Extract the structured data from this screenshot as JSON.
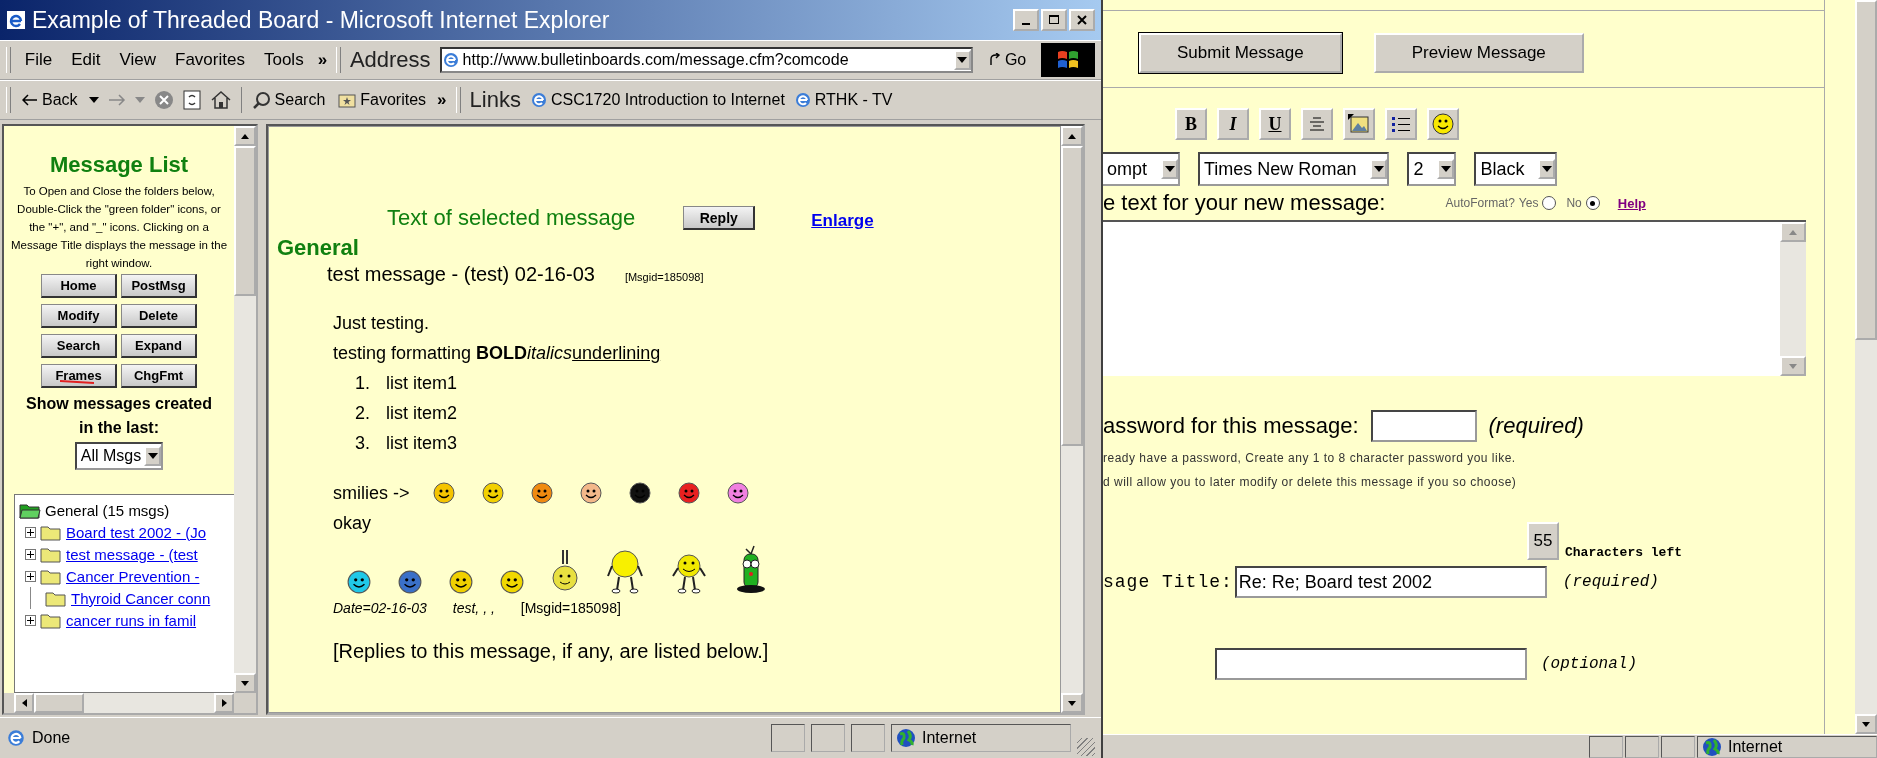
{
  "front_window": {
    "title": "Example of Threaded Board - Microsoft Internet Explorer",
    "menu": {
      "items": [
        "File",
        "Edit",
        "View",
        "Favorites",
        "Tools"
      ],
      "more": "»"
    },
    "address": {
      "label": "Address",
      "value": "http://www.bulletinboards.com/message.cfm?comcode",
      "go": "Go"
    },
    "toolbar": {
      "back": "Back",
      "search": "Search",
      "favorites": "Favorites",
      "more": "»"
    },
    "links": {
      "label": "Links",
      "items": [
        "CSC1720 Introduction to Internet",
        "RTHK - TV"
      ]
    },
    "left_frame": {
      "heading": "Message List",
      "instructions": [
        "To Open and Close the folders below,",
        "Double-Click the \"green folder\" icons, or the \"+\", and \"_\" icons. Clicking on a Message Title displays the message in the right window."
      ],
      "buttons": [
        {
          "label": "Home",
          "struck": false
        },
        {
          "label": "PostMsg",
          "struck": false
        },
        {
          "label": "Modify",
          "struck": false
        },
        {
          "label": "Delete",
          "struck": false
        },
        {
          "label": "Search",
          "struck": false
        },
        {
          "label": "Expand",
          "struck": false
        },
        {
          "label": "Frames",
          "struck": true
        },
        {
          "label": "ChgFmt",
          "struck": false
        }
      ],
      "filter_label": "Show messages created in the last:",
      "filter_value": "All Msgs",
      "tree": {
        "label": "General (15 msgs)",
        "expanded": true,
        "children": [
          {
            "label": "Board test 2002 - (Jo",
            "expandable": true
          },
          {
            "label": "test message - (test",
            "expandable": true
          },
          {
            "label": "Cancer Prevention -",
            "expandable": true
          },
          {
            "label": "Thyroid Cancer conn",
            "expandable": false
          },
          {
            "label": "cancer runs in famil",
            "expandable": true
          }
        ]
      }
    },
    "message_frame": {
      "caption": "Text of selected message",
      "reply": "Reply",
      "enlarge": "Enlarge",
      "board": "General",
      "title": "test message - (test) 02-16-03",
      "msgid": "[Msgid=185098]",
      "body_first": "Just testing.",
      "formatting_line": [
        {
          "text": "testing formatting ",
          "kind": "plain"
        },
        {
          "text": "BOLD",
          "kind": "bold"
        },
        {
          "text": "italics",
          "kind": "italic"
        },
        {
          "text": "underlining",
          "kind": "underline"
        }
      ],
      "list": [
        {
          "number": "1.",
          "text": "list item1"
        },
        {
          "number": "2.",
          "text": "list item2"
        },
        {
          "number": "3.",
          "text": "list item3"
        }
      ],
      "smilies_label": "smilies ->",
      "okay": "okay",
      "date": "Date=02-16-03",
      "author": "test, , ,",
      "footer_msgid": "[Msgid=185098]",
      "replies_note": "[Replies to this message, if any, are listed below.]"
    },
    "status_bar": {
      "text": "Done",
      "zone": "Internet"
    }
  },
  "back_window": {
    "buttons": [
      "Submit Message",
      "Preview Message"
    ],
    "format_buttons": [
      {
        "kind": "bold",
        "label": "B"
      },
      {
        "kind": "italic",
        "label": "I"
      },
      {
        "kind": "underline",
        "label": "U"
      },
      {
        "kind": "center"
      },
      {
        "kind": "image"
      },
      {
        "kind": "list"
      },
      {
        "kind": "smiley"
      }
    ],
    "selects": [
      "ompt",
      "Times New Roman",
      "2",
      "Black"
    ],
    "message_label": "e text for your new message:",
    "autoformat": {
      "label": "AutoFormat?",
      "options": [
        {
          "label": "Yes",
          "selected": false
        },
        {
          "label": "No",
          "selected": true
        }
      ],
      "help": "Help"
    },
    "password": {
      "label": "assword for this message:",
      "note": "(required)",
      "hint_1": "ready have a password, Create any 1 to 8 character password you like.",
      "hint_2": "d will allow you to later modify or delete this message if you so choose)"
    },
    "counter": {
      "value": "55",
      "label": "Characters left"
    },
    "title_field": {
      "label": "sage Title:",
      "value": "Re: Re; Board test 2002",
      "note": "(required)"
    },
    "optional_field": {
      "note": "(optional)"
    },
    "status_bar": {
      "zone": "Internet"
    }
  }
}
